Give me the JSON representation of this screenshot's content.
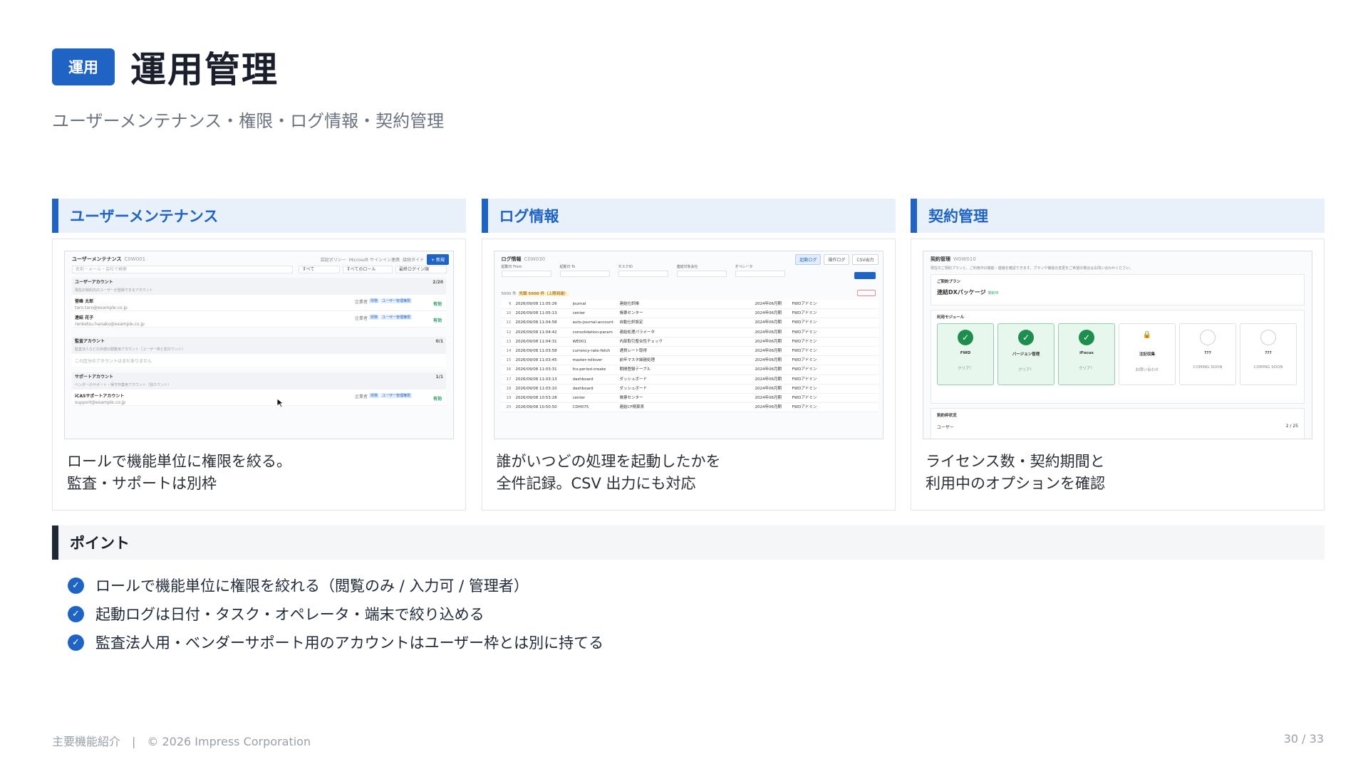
{
  "header": {
    "badge": "運用",
    "title": "運用管理",
    "subtitle": "ユーザーメンテナンス・権限・ログ情報・契約管理"
  },
  "cards": [
    {
      "heading": "ユーザーメンテナンス",
      "desc_lines": [
        "ロールで機能単位に権限を絞る。",
        "監査・サポートは別枠"
      ],
      "shot": {
        "title": "ユーザーメンテナンス",
        "title_sub": "C0W001",
        "toolbar": [
          "認証ポリシー",
          "Microsoft サインイン連携",
          "接続ガイド"
        ],
        "new_button": "+ 新規",
        "search_placeholder": "名前・メール・会社で検索",
        "filters": [
          "すべて",
          "すべてのロール",
          "最終ログイン順"
        ],
        "groups": [
          {
            "title": "ユーザーアカウント",
            "note": "現在の契約内のユーザーが登録できるアカウント",
            "count": "2/20",
            "rows": [
              {
                "name": "菅峰 太郎",
                "email": "taro.taro@example.co.jp",
                "role": "企業者",
                "tag1": "財務",
                "tag2": "ユーザー管理権限",
                "status": "有効"
              },
              {
                "name": "連結 花子",
                "email": "renketsu.hanako@example.co.jp",
                "role": "企業者",
                "tag1": "財務",
                "tag2": "ユーザー管理権限",
                "status": "有効"
              }
            ]
          },
          {
            "title": "監査アカウント",
            "note": "監査法人などの外部の閲覧用アカウント（ユーザー枠と別カウント）",
            "count": "0/1",
            "empty": "この区分のアカウントはまだありません"
          },
          {
            "title": "サポートアカウント",
            "note": "ベンダーのサポート・保守作業用アカウント（別カウント）",
            "count": "1/1",
            "rows": [
              {
                "name": "iCASサポートアカウント",
                "email": "support@example.co.jp",
                "role": "企業者",
                "tag1": "財務",
                "tag2": "ユーザー管理権限",
                "status": "有効"
              }
            ]
          }
        ]
      }
    },
    {
      "heading": "ログ情報",
      "desc_lines": [
        "誰がいつどの処理を起動したかを",
        "全件記録。CSV 出力にも対応"
      ],
      "shot": {
        "title": "ログ情報",
        "title_sub": "C0W030",
        "tabs": [
          "起動ログ",
          "操作ログ",
          "CSV出力"
        ],
        "fields": [
          "起動日 From",
          "起動日 To",
          "タスクID",
          "連結対象会社",
          "オペレータ"
        ],
        "count_text": "5000 件",
        "limit_text": "先頭 5000 件（上限到達）",
        "rows": [
          {
            "no": "9",
            "dt": "2026/09/08 11:05:26",
            "task": "journal",
            "name": "連結仕訳帳",
            "co": "2024年06月期",
            "op": "FWDアドミン"
          },
          {
            "no": "10",
            "dt": "2026/09/08 11:05:13",
            "task": "center",
            "name": "帳票センター",
            "co": "2024年06月期",
            "op": "FWDアドミン"
          },
          {
            "no": "11",
            "dt": "2026/09/08 11:04:58",
            "task": "auto-journal-account",
            "name": "自動仕訳設定",
            "co": "2024年06月期",
            "op": "FWDアドミン"
          },
          {
            "no": "12",
            "dt": "2026/09/08 11:04:42",
            "task": "consolidation-param",
            "name": "連結処理パラメータ",
            "co": "2024年06月期",
            "op": "FWDアドミン"
          },
          {
            "no": "13",
            "dt": "2026/09/08 11:04:31",
            "task": "WE001",
            "name": "内部取引整合性チェック",
            "co": "2024年06月期",
            "op": "FWDアドミン"
          },
          {
            "no": "14",
            "dt": "2026/09/08 11:03:58",
            "task": "currency-rate-fetch",
            "name": "通貨レート取得",
            "co": "2024年06月期",
            "op": "FWDアドミン"
          },
          {
            "no": "15",
            "dt": "2026/09/08 11:03:45",
            "task": "master-rollover",
            "name": "前年マスタ繰越処理",
            "co": "2024年06月期",
            "op": "FWDアドミン"
          },
          {
            "no": "16",
            "dt": "2026/09/08 11:03:31",
            "task": "fcs-period-create",
            "name": "期間登録テーブル",
            "co": "2024年06月期",
            "op": "FWDアドミン"
          },
          {
            "no": "17",
            "dt": "2026/09/08 11:03:13",
            "task": "dashboard",
            "name": "ダッシュボード",
            "co": "2024年06月期",
            "op": "FWDアドミン"
          },
          {
            "no": "18",
            "dt": "2026/09/08 11:03:10",
            "task": "dashboard",
            "name": "ダッシュボード",
            "co": "2024年06月期",
            "op": "FWDアドミン"
          },
          {
            "no": "19",
            "dt": "2026/09/08 10:53:28",
            "task": "center",
            "name": "帳票センター",
            "co": "2024年06月期",
            "op": "FWDアドミン"
          },
          {
            "no": "20",
            "dt": "2026/09/08 10:50:50",
            "task": "CDH075",
            "name": "連結CF精算表",
            "co": "2024年06月期",
            "op": "FWDアドミン"
          }
        ]
      }
    },
    {
      "heading": "契約管理",
      "desc_lines": [
        "ライセンス数・契約期間と",
        "利用中のオプションを確認"
      ],
      "shot": {
        "title": "契約管理",
        "title_sub": "W0W010",
        "note": "現在のご契約プランと、ご利用中の機能・連絡を確認できます。プランや機能の変更をご希望の場合はお問い合わせください。",
        "plan_label": "ご契約プラン",
        "plan_name": "連結DXパッケージ",
        "plan_status": "契約中",
        "modules_label": "利用モジュール",
        "modules": [
          {
            "name": "FWD",
            "sub": "クリア！",
            "state": "on"
          },
          {
            "name": "バージョン管理",
            "sub": "クリア！",
            "state": "on"
          },
          {
            "name": "iFocus",
            "sub": "クリア！",
            "state": "on"
          },
          {
            "name": "注記収集",
            "sub": "お問い合わせ",
            "state": "lock"
          },
          {
            "name": "???",
            "sub": "COMING SOON",
            "state": "empty"
          },
          {
            "name": "???",
            "sub": "COMING SOON",
            "state": "empty"
          }
        ],
        "license_label": "契約枠状況",
        "users_label": "ユーザー",
        "users_count": "2 / 25"
      }
    }
  ],
  "point": {
    "heading": "ポイント",
    "items": [
      "ロールで機能単位に権限を絞れる（閲覧のみ / 入力可 / 管理者）",
      "起動ログは日付・タスク・オペレータ・端末で絞り込める",
      "監査法人用・ベンダーサポート用のアカウントはユーザー枠とは別に持てる"
    ]
  },
  "footer": {
    "section": "主要機能紹介",
    "separator": "|",
    "copyright": "© 2026 Impress Corporation",
    "page": "30 / 33"
  },
  "colors": {
    "accent": "#1f64c4",
    "success": "#1e8e4e",
    "dark": "#1f2937"
  },
  "icons": {
    "check": "check-circle-icon",
    "cursor": "mouse-pointer-icon"
  }
}
